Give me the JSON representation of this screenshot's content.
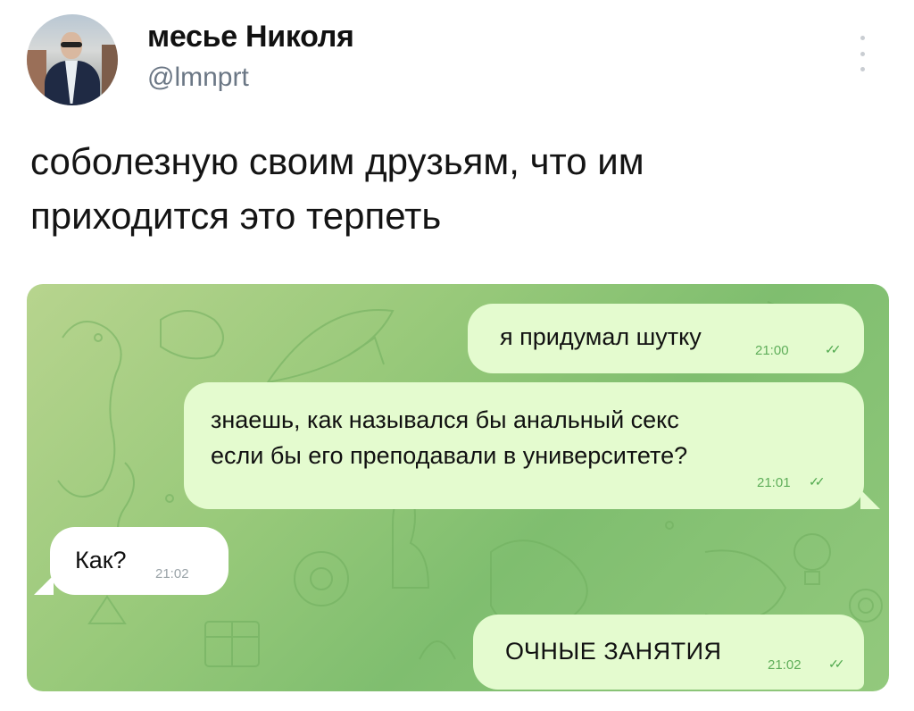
{
  "author": {
    "name": "месье Николя",
    "handle": "@lmnprt"
  },
  "tweet": {
    "text_line1": "соболезную своим друзьям, что им",
    "text_line2": "приходится это терпеть"
  },
  "chat": {
    "messages": [
      {
        "direction": "outgoing",
        "text": "я придумал шутку",
        "time": "21:00",
        "status": "read"
      },
      {
        "direction": "outgoing",
        "line1": "знаешь, как назывался бы анальный секс",
        "line2": "если бы его преподавали в университете?",
        "time": "21:01",
        "status": "read"
      },
      {
        "direction": "incoming",
        "text": "Как?",
        "time": "21:02"
      },
      {
        "direction": "outgoing",
        "text": "ОЧНЫЕ ЗАНЯТИЯ",
        "time": "21:02",
        "status": "read"
      }
    ],
    "colors": {
      "outgoing_bubble": "#e4fbcf",
      "incoming_bubble": "#ffffff",
      "wallpaper": "#98c97a",
      "check_color": "#4fa84d"
    }
  },
  "icons": {
    "more": "more-vertical-icon",
    "read": "double-check-icon"
  }
}
